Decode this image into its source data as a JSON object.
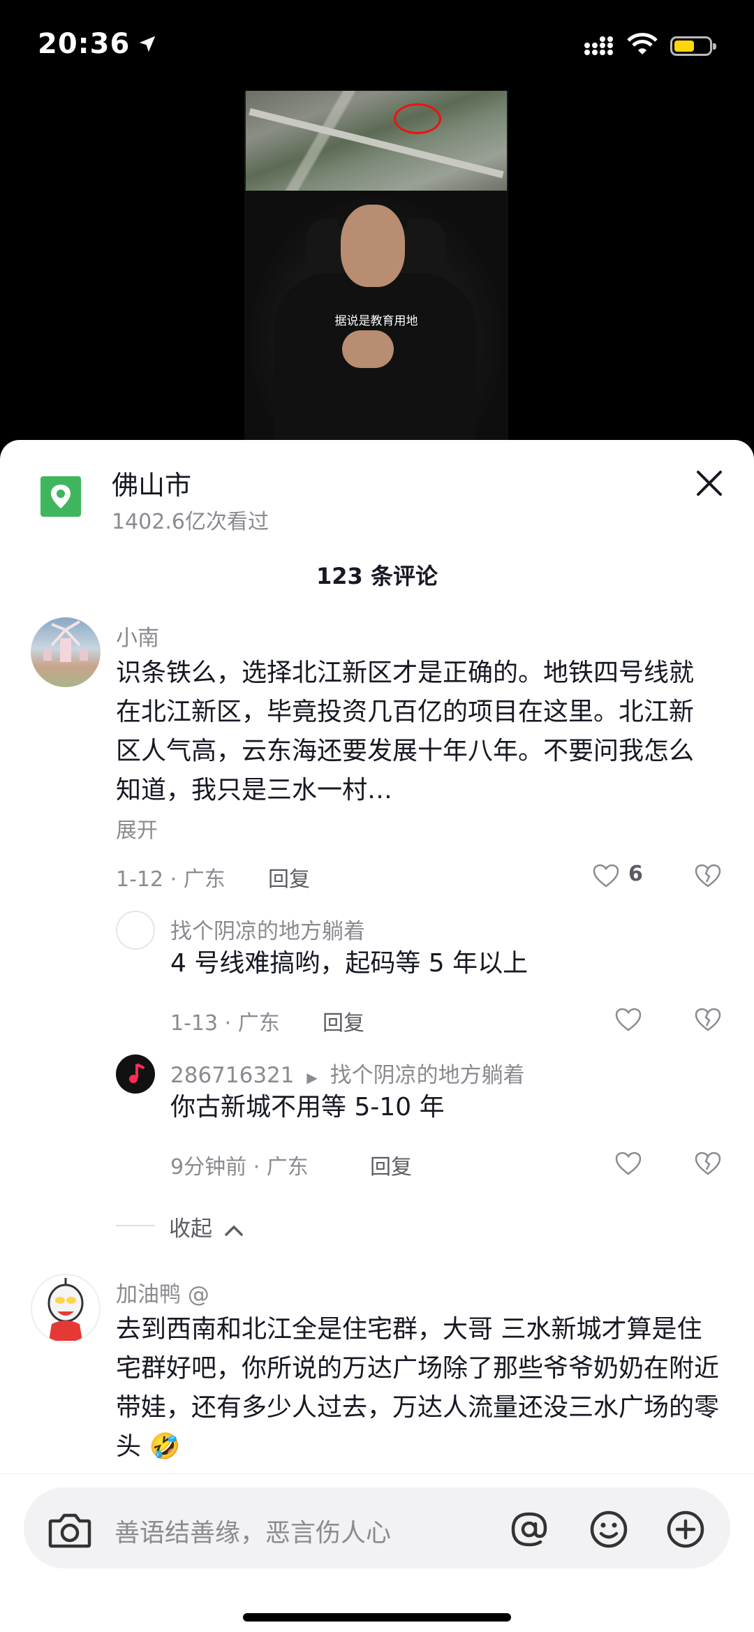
{
  "status_bar": {
    "time": "20:36"
  },
  "video": {
    "subtitle": "据说是教育用地"
  },
  "panel": {
    "location_name": "佛山市",
    "views": "1402.6亿次看过",
    "comment_count": "123 条评论"
  },
  "comments": [
    {
      "user": "小南",
      "text": "识条铁么，选择北江新区才是正确的。地铁四号线就在北江新区，毕竟投资几百亿的项目在这里。北江新区人气高，云东海还要发展十年八年。不要问我怎么知道，我只是三水一村…",
      "expand": "展开",
      "meta": "1-12 · 广东",
      "reply": "回复",
      "likes": "6"
    },
    {
      "user": "找个阴凉的地方躺着",
      "text": "4 号线难搞哟，起码等 5 年以上",
      "meta": "1-13 · 广东",
      "reply": "回复"
    },
    {
      "user": "286716321",
      "reply_to": "找个阴凉的地方躺着",
      "text": "你古新城不用等 5-10 年",
      "meta": "9分钟前 · 广东",
      "reply": "回复"
    },
    {
      "user": "加油鸭 @",
      "text": "去到西南和北江全是住宅群，大哥 三水新城才算是住宅群好吧，你所说的万达广场除了那些爷爷奶奶在附近带娃，还有多少人过去，万达人流量还没三水广场的零头 🤣"
    }
  ],
  "collapse_label": "收起",
  "input": {
    "placeholder": "善语结善缘，恶言伤人心"
  },
  "colors": {
    "location": "#3fb65e",
    "battery": "#ffd60a",
    "text": "#161823",
    "muted": "#8a8b91"
  }
}
